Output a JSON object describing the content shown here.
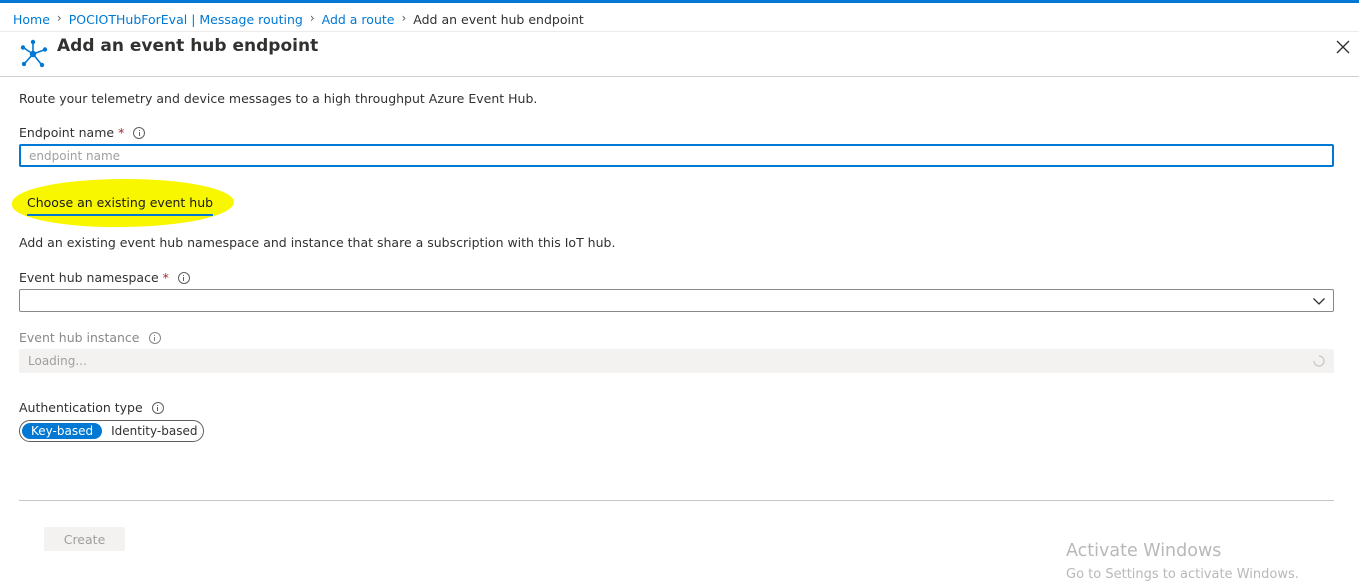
{
  "breadcrumb": {
    "items": [
      "Home",
      "POCIOTHubForEval | Message routing",
      "Add a route"
    ],
    "current": "Add an event hub endpoint"
  },
  "header": {
    "title": "Add an event hub endpoint",
    "icon": "event-hub-icon"
  },
  "description": "Route your telemetry and device messages to a high throughput Azure Event Hub.",
  "endpoint_name": {
    "label": "Endpoint name",
    "required_mark": "*",
    "value": "",
    "placeholder": "endpoint name"
  },
  "tab": {
    "label": "Choose an existing event hub"
  },
  "sub_description": "Add an existing event hub namespace and instance that share a subscription with this IoT hub.",
  "namespace": {
    "label": "Event hub namespace",
    "required_mark": "*",
    "value": ""
  },
  "instance": {
    "label": "Event hub instance",
    "value": "Loading..."
  },
  "auth": {
    "label": "Authentication type",
    "options": [
      "Key-based",
      "Identity-based"
    ],
    "selected": "Key-based"
  },
  "footer": {
    "create_label": "Create"
  },
  "watermark": {
    "title": "Activate Windows",
    "subtitle": "Go to Settings to activate Windows."
  },
  "colors": {
    "accent": "#0078d4",
    "required": "#a4262c",
    "highlight": "#f8f700"
  }
}
